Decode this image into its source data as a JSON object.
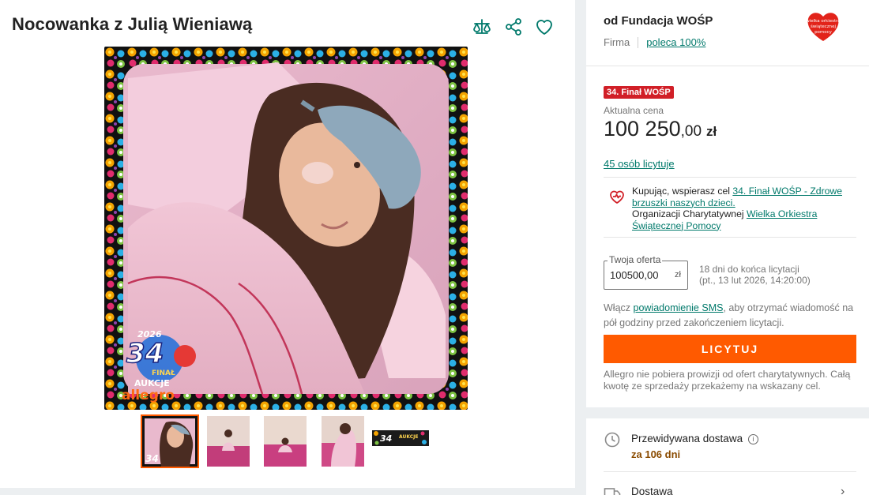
{
  "title": "Nocowanka z Julią Wieniawą",
  "actions": {
    "compare_icon": "scales-icon",
    "share_icon": "share-icon",
    "favorite_icon": "heart-icon"
  },
  "gallery": {
    "main_image_overlay": {
      "badge_year": "2026",
      "badge_number": "34",
      "badge_line1": "FINAŁ",
      "badge_line2": "AUKCJE",
      "brand": "allegro",
      "heart_logo": "wielka orkiestra świątecznej pomocy"
    },
    "thumbnails_count": 5,
    "strip_badge_number": "34",
    "strip_badge_text": "AUKCJE"
  },
  "seller": {
    "name": "od Fundacja WOŚP",
    "type": "Firma",
    "recommend": "poleca 100%",
    "logo_text": "wielka orkiestra świątecznej pomocy"
  },
  "offer": {
    "badge": "34. Finał WOŚP",
    "price_label": "Aktualna cena",
    "price_main": "100 250",
    "price_fraction": ",00",
    "currency": "zł",
    "bidders": "45 osób licytuje",
    "charity": {
      "text1": "Kupując, wspierasz cel ",
      "goal_link": "34. Finał WOŚP - Zdrowe brzuszki naszych dzieci.",
      "text2": "Organizacji Charytatywnej ",
      "org_link": "Wielka Orkiestra Świątecznej Pomocy"
    },
    "bid_label": "Twoja oferta",
    "bid_value": "100500,00",
    "bid_currency": "zł",
    "deadline_line1": "18 dni do końca licytacji",
    "deadline_line2": "(pt., 13 lut 2026, 14:20:00)",
    "sms_text1": "Włącz ",
    "sms_link": "powiadomienie SMS",
    "sms_text2": ", aby otrzymać wiadomość na pół godziny przed zakończeniem licytacji.",
    "bid_button": "LICYTUJ",
    "note": "Allegro nie pobiera prowizji od ofert charytatywnych. Całą kwotę ze sprzedaży przekażemy na wskazany cel."
  },
  "delivery": {
    "expected_label": "Przewidywana dostawa",
    "expected_value": "za 106 dni",
    "shipping_label": "Dostawa"
  },
  "colors": {
    "accent": "#ff5a00",
    "link": "#00796b",
    "badge": "#d11f27",
    "icon_teal": "#00796b"
  }
}
